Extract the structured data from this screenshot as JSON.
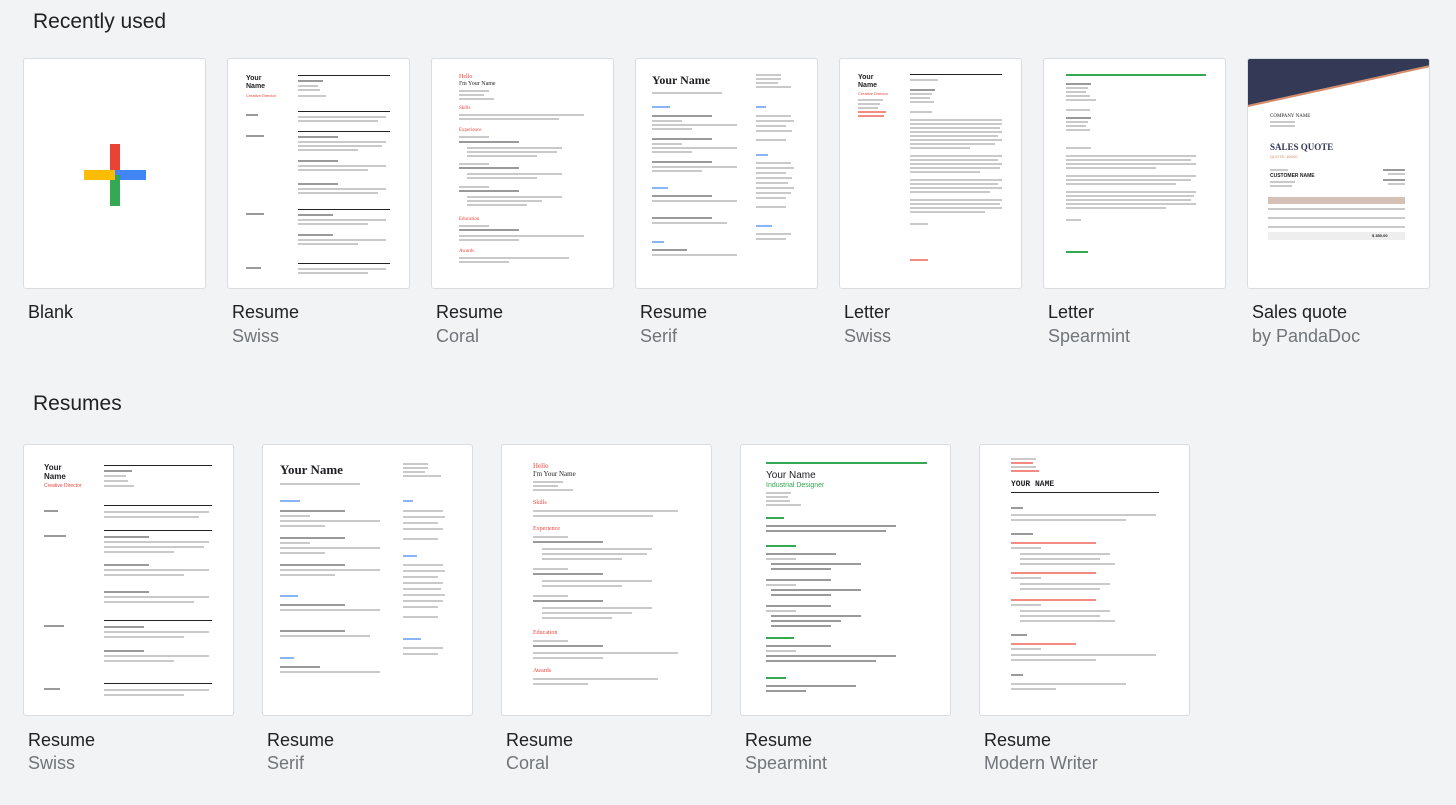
{
  "sections": {
    "recent": "Recently used",
    "resumes": "Resumes"
  },
  "recent": [
    {
      "title": "Blank",
      "subtitle": ""
    },
    {
      "title": "Resume",
      "subtitle": "Swiss"
    },
    {
      "title": "Resume",
      "subtitle": "Coral"
    },
    {
      "title": "Resume",
      "subtitle": "Serif"
    },
    {
      "title": "Letter",
      "subtitle": "Swiss"
    },
    {
      "title": "Letter",
      "subtitle": "Spearmint"
    },
    {
      "title": "Sales quote",
      "subtitle": "by PandaDoc"
    }
  ],
  "resumes": [
    {
      "title": "Resume",
      "subtitle": "Swiss"
    },
    {
      "title": "Resume",
      "subtitle": "Serif"
    },
    {
      "title": "Resume",
      "subtitle": "Coral"
    },
    {
      "title": "Resume",
      "subtitle": "Spearmint"
    },
    {
      "title": "Resume",
      "subtitle": "Modern Writer"
    }
  ],
  "thumb_text": {
    "your_name_stacked": "Your\nName",
    "your_name": "Your Name",
    "creative_director": "Creative Director",
    "industrial_designer": "Industrial Designer",
    "hello": "Hello",
    "im_your_name": "I'm Your Name",
    "your_name_upper": "YOUR NAME",
    "skills": "Skills",
    "experience": "Experience",
    "education": "Education",
    "awards": "Awards",
    "company_name": "COMPANY NAME",
    "sales_quote": "SALES QUOTE",
    "quote_no": "QUOTE: #0000",
    "customer_name": "CUSTOMER NAME",
    "total": "$ 350.00"
  },
  "colors": {
    "accent_red": "#e8453c",
    "accent_green": "#34a853",
    "accent_blue": "#1a73e8",
    "navy": "#343a56",
    "salmon": "#d78a67"
  },
  "icons": {
    "blank": "google-plus-icon"
  }
}
